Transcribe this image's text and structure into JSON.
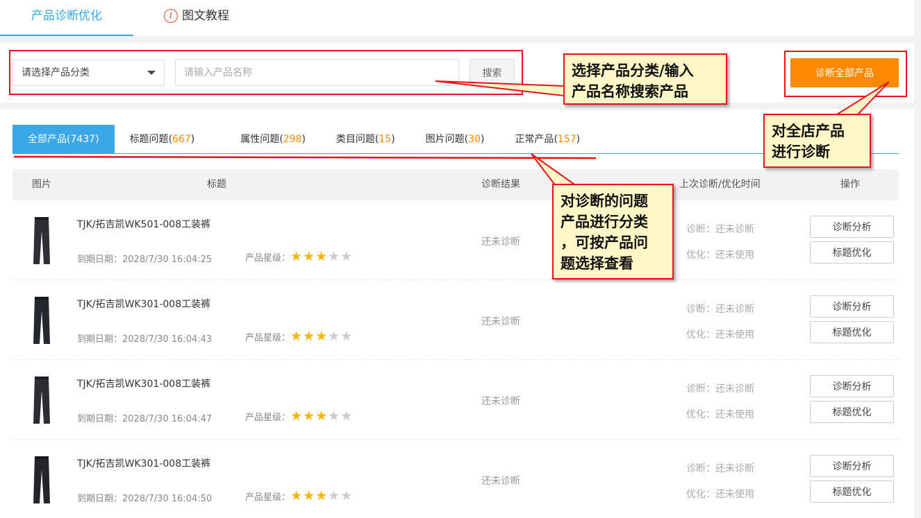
{
  "top_tabs": {
    "active_label": "产品诊断优化",
    "tutorial_label": "图文教程",
    "tutorial_icon": "i"
  },
  "search": {
    "category_placeholder": "请选择产品分类",
    "name_placeholder": "请输入产品名称",
    "search_label": "搜索",
    "diagnose_all_label": "诊断全部产品"
  },
  "tabs": [
    {
      "label": "全部产品",
      "count": "(7437)"
    },
    {
      "label": "标题问题",
      "count": "667"
    },
    {
      "label": "属性问题",
      "count": "298"
    },
    {
      "label": "类目问题",
      "count": "15"
    },
    {
      "label": "图片问题",
      "count": "30"
    },
    {
      "label": "正常产品",
      "count": "157"
    }
  ],
  "table_header": {
    "image": "图片",
    "title": "标题",
    "result": "诊断结果",
    "time": "上次诊断/优化时间",
    "ops": "操作"
  },
  "rows": [
    {
      "title": "TJK/拓吉凯WK501-008工装裤",
      "expire": "到期日期：2028/7/30 16:04:25",
      "star_label": "产品星级：",
      "stars": 3,
      "result": "还未诊断",
      "diag_time": "诊断：还未诊断",
      "opt_time": "优化：还未使用",
      "btn_analyze": "诊断分析",
      "btn_optimize": "标题优化"
    },
    {
      "title": "TJK/拓吉凯WK301-008工装裤",
      "expire": "到期日期：2028/7/30 16:04:43",
      "star_label": "产品星级：",
      "stars": 3,
      "result": "还未诊断",
      "diag_time": "诊断：还未诊断",
      "opt_time": "优化：还未使用",
      "btn_analyze": "诊断分析",
      "btn_optimize": "标题优化"
    },
    {
      "title": "TJK/拓吉凯WK301-008工装裤",
      "expire": "到期日期：2028/7/30 16:04:47",
      "star_label": "产品星级：",
      "stars": 3,
      "result": "还未诊断",
      "diag_time": "诊断：还未诊断",
      "opt_time": "优化：还未使用",
      "btn_analyze": "诊断分析",
      "btn_optimize": "标题优化"
    },
    {
      "title": "TJK/拓吉凯WK301-008工装裤",
      "expire": "到期日期：2028/7/30 16:04:50",
      "star_label": "产品星级：",
      "stars": 3,
      "result": "还未诊断",
      "diag_time": "诊断：还未诊断",
      "opt_time": "优化：还未使用",
      "btn_analyze": "诊断分析",
      "btn_optimize": "标题优化"
    }
  ],
  "annotations": {
    "search_note_line1": "选择产品分类/输入",
    "search_note_line2": "产品名称搜索产品",
    "diagnose_note_line1": "对全店产品",
    "diagnose_note_line2": "进行诊断",
    "tabs_note_line1": "对诊断的问题",
    "tabs_note_line2": "产品进行分类",
    "tabs_note_line3": "，可按产品问",
    "tabs_note_line4": "题选择查看"
  },
  "colors": {
    "accent_blue": "#3aa7e8",
    "accent_orange": "#ff8a00",
    "annotation_red": "#e6131b",
    "callout_fill": "#fff8c6",
    "star_on": "#f5b600"
  }
}
